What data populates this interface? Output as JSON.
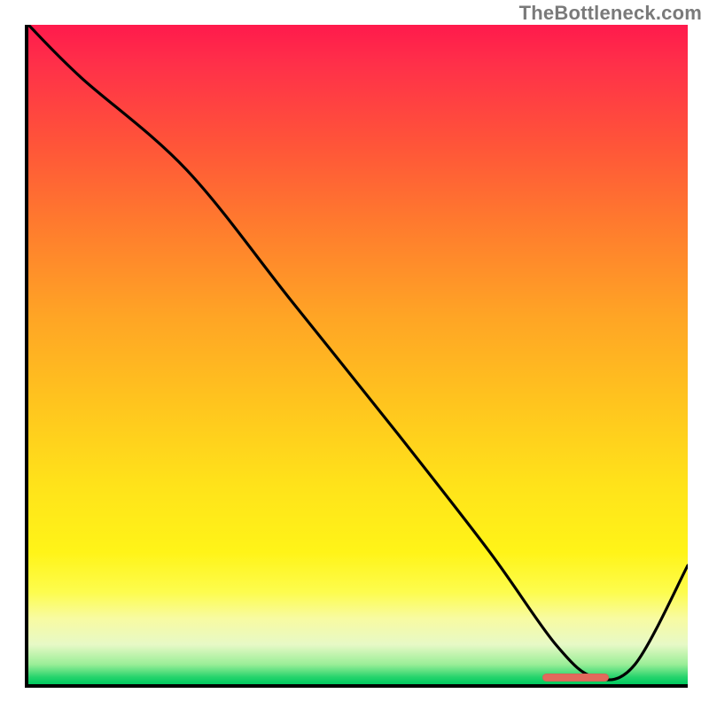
{
  "watermark": "TheBottleneck.com",
  "chart_data": {
    "type": "line",
    "title": "",
    "xlabel": "",
    "ylabel": "",
    "xlim": [
      0,
      100
    ],
    "ylim": [
      0,
      100
    ],
    "grid": false,
    "legend": false,
    "series": [
      {
        "name": "curve",
        "x": [
          0,
          8,
          24,
          40,
          56,
          70,
          80,
          86,
          92,
          100
        ],
        "values": [
          100,
          92,
          78,
          58,
          38,
          20,
          6,
          1,
          3,
          18
        ]
      }
    ],
    "gradient_note": "vertical gradient background red→orange→yellow→green",
    "marker": {
      "x_start": 78,
      "x_end": 88,
      "y": 1,
      "color": "#e2695c"
    }
  }
}
